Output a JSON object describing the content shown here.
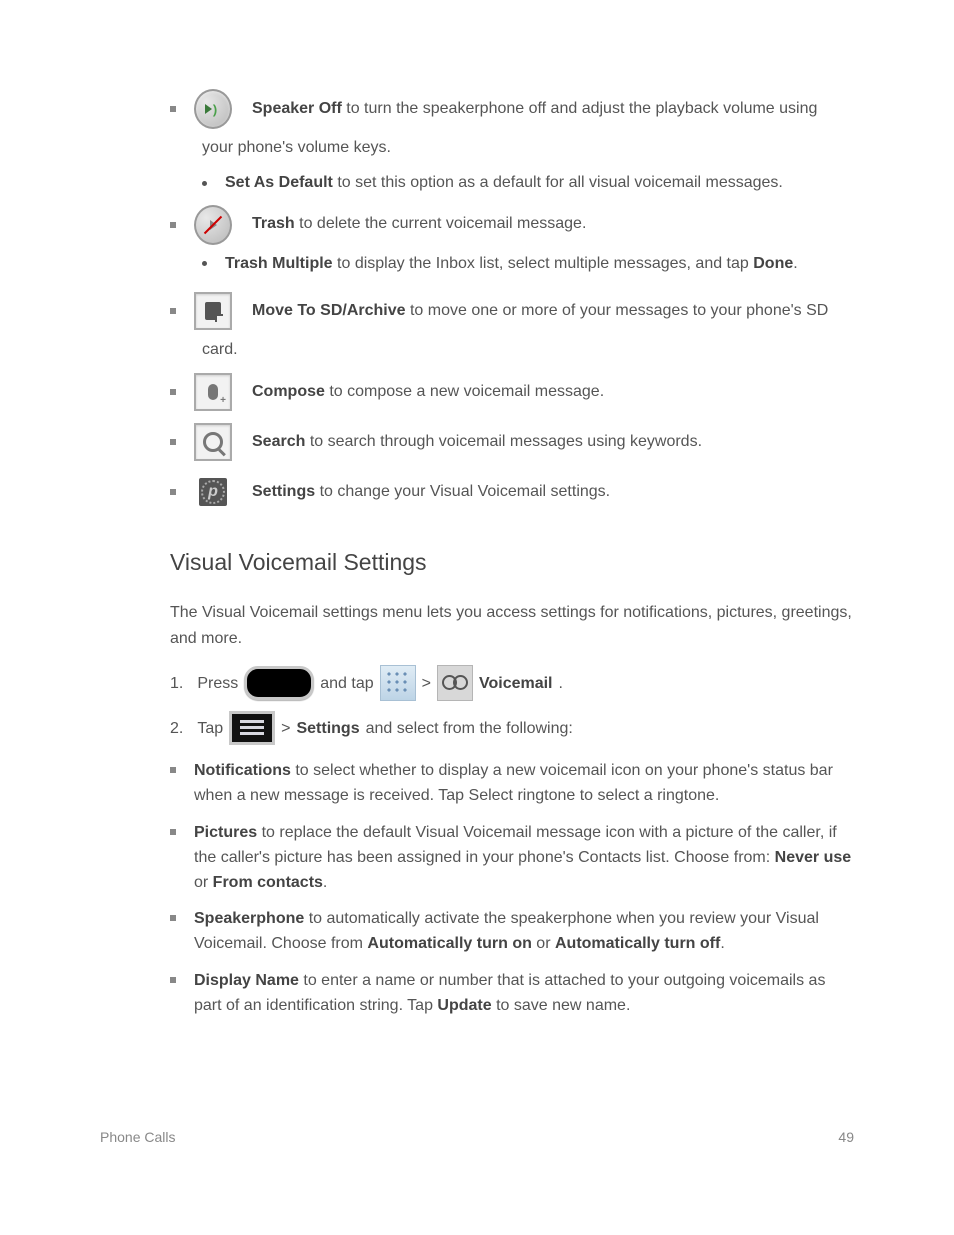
{
  "items": {
    "speaker": {
      "label1": "Speaker Off",
      "text1": " to turn the speakerphone off and adjust the playback volume using",
      "text2": "your phone's volume keys.",
      "sub_label": "Set As Default",
      "sub_text": " to set this option as a default for all visual voicemail messages."
    },
    "trash": {
      "label1": "Trash",
      "text1": " to delete the current voicemail message.",
      "sub_label": "Trash Multiple",
      "sub_text": " to display the Inbox list, select multiple messages, and tap ",
      "sub_action_label": "Done",
      "sub_text2": "."
    },
    "archive": {
      "label1": "Move To SD/Archive",
      "text1": " to move one or more of your messages to your phone's SD",
      "text2": "card."
    },
    "compose": {
      "label1": "Compose",
      "text1": " to compose a new voicemail message."
    },
    "search": {
      "label1": "Search",
      "text1": " to search through voicemail messages using keywords."
    },
    "settings": {
      "label1": "Settings",
      "text1": " to change your Visual Voicemail settings."
    }
  },
  "section": {
    "heading": "Visual Voicemail Settings",
    "intro": "The Visual Voicemail settings menu lets you access settings for notifications, pictures, greetings, and more."
  },
  "step": {
    "num": "1.",
    "prefix": "Press",
    "mid1": " and tap ",
    "gt": " > ",
    "vm_label": "Voicemail",
    "period": "."
  },
  "step2": {
    "num": "2.",
    "prefix": "Tap",
    "gt": " > ",
    "settings_label": "Settings",
    "after": " and select from the following:"
  },
  "opts": {
    "notifications": {
      "label": "Notifications",
      "text": " to select whether to display a new voicemail icon on your phone's status bar when a new message is received. Tap Select ringtone to select a ringtone."
    },
    "pictures": {
      "label": "Pictures",
      "text": " to replace the default Visual Voicemail message icon with a picture of the caller, if the caller's picture has been assigned in your phone's Contacts list. Choose from: ",
      "opt1": "Never use",
      "or": " or ",
      "opt2": "From contacts",
      "period": "."
    },
    "speakerphone": {
      "label": "Speakerphone",
      "text": " to automatically activate the speakerphone when you review your Visual Voicemail. Choose from ",
      "opt1": "Automatically turn on",
      "or": " or ",
      "opt2": "Automatically turn off",
      "period": "."
    },
    "display": {
      "label": "Display Name",
      "text": " to enter a name or number that is attached to your outgoing voicemails as part of an identification string. Tap ",
      "action": "Update",
      "after": " to save new name."
    }
  },
  "footer": {
    "left": "Phone Calls",
    "right": "49"
  }
}
